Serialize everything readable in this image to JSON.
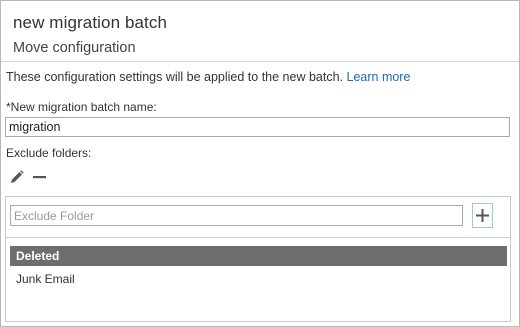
{
  "dialog": {
    "title": "new migration batch",
    "subtitle": "Move configuration",
    "info_text": "These configuration settings will be applied to the new batch.",
    "learn_more": "Learn more"
  },
  "form": {
    "name_label": "*New migration batch name:",
    "name_value": "migration",
    "exclude_label": "Exclude folders:",
    "exclude_placeholder": "Exclude Folder"
  },
  "toolbar": {
    "edit_icon": "pencil-icon",
    "remove_icon": "minus-icon",
    "add_icon": "plus-icon"
  },
  "folders": [
    {
      "name": "Deleted",
      "selected": true
    },
    {
      "name": "Junk Email",
      "selected": false
    }
  ],
  "colors": {
    "link": "#1e6ab3",
    "selected_row": "#6e6e6e",
    "add_button_border": "#9fc4e4"
  }
}
